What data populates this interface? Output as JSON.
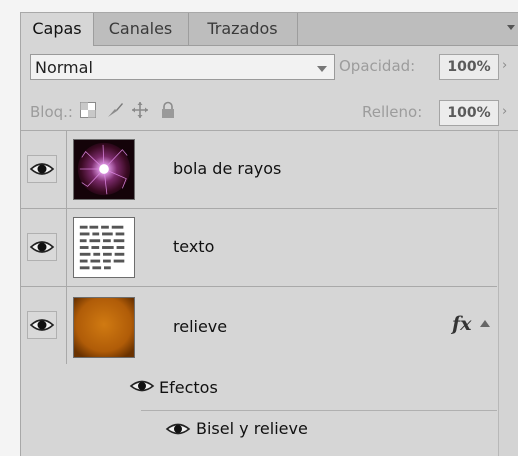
{
  "tabs": [
    {
      "label": "Capas"
    },
    {
      "label": "Canales"
    },
    {
      "label": "Trazados"
    }
  ],
  "blend": {
    "mode": "Normal",
    "opacity_label": "Opacidad:",
    "opacity_value": "100%",
    "opacity_arrow": "›"
  },
  "lock": {
    "label": "Bloq.:",
    "fill_label": "Relleno:",
    "fill_value": "100%",
    "fill_arrow": "›"
  },
  "layers": [
    {
      "name": "bola de rayos",
      "thumb": "plasma-ball"
    },
    {
      "name": "texto",
      "thumb": "text-grid"
    },
    {
      "name": "relieve",
      "thumb": "orange-gradient",
      "fx": "fx"
    }
  ],
  "effects": {
    "label": "Efectos",
    "items": [
      {
        "label": "Bisel y relieve"
      }
    ]
  },
  "colors": {
    "panel_bg": "#d6d6d6",
    "thumb_orange": "#c06a10"
  }
}
